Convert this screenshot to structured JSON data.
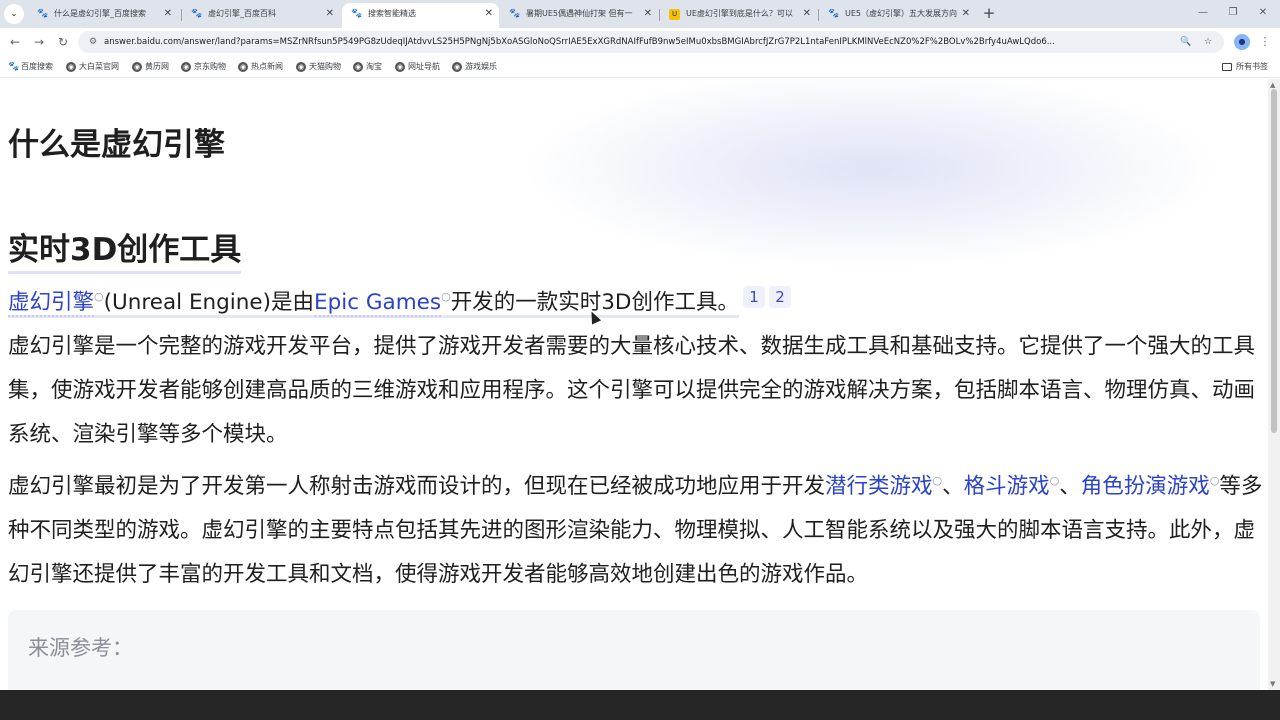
{
  "browser": {
    "tabs": [
      {
        "label": "什么是虚幻引擎_百度搜索",
        "icon": "baidu-paw-icon"
      },
      {
        "label": "虚幻引擎_百度百科",
        "icon": "baidu-paw-icon"
      },
      {
        "label": "搜索智能精选",
        "icon": "baidu-paw-icon",
        "active": true
      },
      {
        "label": "暑期UE5偶遇神仙打架 但有一",
        "icon": "paw-icon"
      },
      {
        "label": "UE虚幻引擎到底是什么？可以",
        "icon": "ue-icon"
      },
      {
        "label": "UE5（虚幻引擎）五大发展方向",
        "icon": "paw-icon"
      }
    ],
    "new_tab": "+",
    "window_controls": {
      "minimize": "—",
      "restore": "❐",
      "close": "✕"
    },
    "url": "answer.baidu.com/answer/land?params=MSZrNRfsun5P549PG8zUdeqIJAtdvvLS25H5PNgNj5bXoASGloNoQSrrIAE5ExXGRdNAIfFufB9nw5eIMu0xbsBMGIAbrcfJZrG7P2L1ntaFenIPLKMlNVeEcNZ0%2F%2BOLv%2Brfy4uAwLQdo6..."
  },
  "bookmarks": {
    "items": [
      "百度搜索",
      "大白菜官网",
      "黄历网",
      "京东购物",
      "热点新闻",
      "天猫购物",
      "淘宝",
      "网址导航",
      "游戏娱乐"
    ],
    "all": "所有书签"
  },
  "article": {
    "title": "什么是虚幻引擎",
    "section": "实时3D创作工具",
    "p1": {
      "link1": "虚幻引擎",
      "text1": "(Unreal Engine)是由",
      "link2": "Epic Games",
      "text2": "开发的一款实时3D创作工具。",
      "cites": [
        "1",
        "2"
      ]
    },
    "p2": "虚幻引擎是一个完整的游戏开发平台，提供了游戏开发者需要的大量核心技术、数据生成工具和基础支持。它提供了一个强大的工具集，使游戏开发者能够创建高品质的三维游戏和应用程序。这个引擎可以提供完全的游戏解决方案，包括脚本语言、物理仿真、动画系统、渲染引擎等多个模块。",
    "p3": {
      "text1": "虚幻引擎最初是为了开发第一人称射击游戏而设计的，但现在已经被成功地应用于开发",
      "link1": "潜行类游戏",
      "sep1": "、",
      "link2": "格斗游戏",
      "sep2": "、",
      "link3": "角色扮演游戏",
      "text2": "等多种不同类型的游戏。虚幻引擎的主要特点包括其先进的图形渲染能力、物理模拟、人工智能系统以及强大的脚本语言支持。此外，虚幻引擎还提供了丰富的开发工具和文档，使得游戏开发者能够高效地创建出色的游戏作品。"
    },
    "source_label": "来源参考："
  }
}
